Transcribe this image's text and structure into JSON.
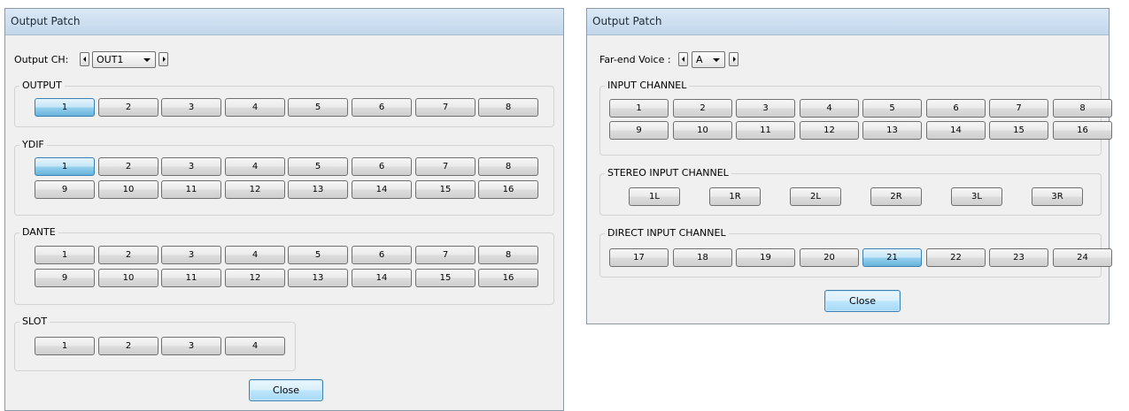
{
  "left_dialog": {
    "title": "Output Patch",
    "selector_label": "Output CH:",
    "selector_value": "OUT1",
    "groups": [
      {
        "title": "OUTPUT",
        "buttons": [
          "1",
          "2",
          "3",
          "4",
          "5",
          "6",
          "7",
          "8"
        ],
        "active": "1"
      },
      {
        "title": "YDIF",
        "buttons": [
          "1",
          "2",
          "3",
          "4",
          "5",
          "6",
          "7",
          "8",
          "9",
          "10",
          "11",
          "12",
          "13",
          "14",
          "15",
          "16"
        ],
        "active": "1"
      },
      {
        "title": "DANTE",
        "buttons": [
          "1",
          "2",
          "3",
          "4",
          "5",
          "6",
          "7",
          "8",
          "9",
          "10",
          "11",
          "12",
          "13",
          "14",
          "15",
          "16"
        ],
        "active": null
      },
      {
        "title": "SLOT",
        "buttons": [
          "1",
          "2",
          "3",
          "4"
        ],
        "active": null
      }
    ],
    "close_label": "Close"
  },
  "right_dialog": {
    "title": "Output Patch",
    "selector_label": "Far-end Voice :",
    "selector_value": "A",
    "groups": [
      {
        "title": "INPUT CHANNEL",
        "buttons": [
          "1",
          "2",
          "3",
          "4",
          "5",
          "6",
          "7",
          "8",
          "9",
          "10",
          "11",
          "12",
          "13",
          "14",
          "15",
          "16"
        ],
        "active": null
      },
      {
        "title": "STEREO INPUT CHANNEL",
        "buttons": [
          "1L",
          "1R",
          "2L",
          "2R",
          "3L",
          "3R"
        ],
        "active": null
      },
      {
        "title": "DIRECT INPUT CHANNEL",
        "buttons": [
          "17",
          "18",
          "19",
          "20",
          "21",
          "22",
          "23",
          "24"
        ],
        "active": "21"
      }
    ],
    "close_label": "Close"
  }
}
